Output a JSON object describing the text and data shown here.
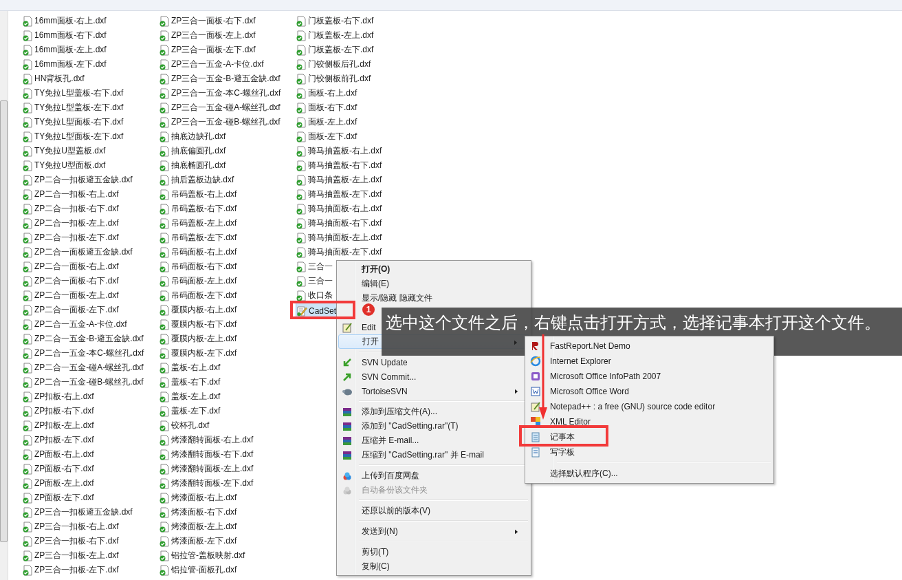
{
  "file_columns": [
    [
      {
        "name": "16mm面板-右上.dxf",
        "kind": "dxf",
        "selected": false
      },
      {
        "name": "16mm面板-右下.dxf",
        "kind": "dxf",
        "selected": false
      },
      {
        "name": "16mm面板-左上.dxf",
        "kind": "dxf",
        "selected": false
      },
      {
        "name": "16mm面板-左下.dxf",
        "kind": "dxf",
        "selected": false
      },
      {
        "name": "HN背板孔.dxf",
        "kind": "dxf",
        "selected": false
      },
      {
        "name": "TY免拉L型盖板-右下.dxf",
        "kind": "dxf",
        "selected": false
      },
      {
        "name": "TY免拉L型盖板-左下.dxf",
        "kind": "dxf",
        "selected": false
      },
      {
        "name": "TY免拉L型面板-右下.dxf",
        "kind": "dxf",
        "selected": false
      },
      {
        "name": "TY免拉L型面板-左下.dxf",
        "kind": "dxf",
        "selected": false
      },
      {
        "name": "TY免拉U型盖板.dxf",
        "kind": "dxf",
        "selected": false
      },
      {
        "name": "TY免拉U型面板.dxf",
        "kind": "dxf",
        "selected": false
      },
      {
        "name": "ZP二合一扣板避五金缺.dxf",
        "kind": "dxf",
        "selected": false
      },
      {
        "name": "ZP二合一扣板-右上.dxf",
        "kind": "dxf",
        "selected": false
      },
      {
        "name": "ZP二合一扣板-右下.dxf",
        "kind": "dxf",
        "selected": false
      },
      {
        "name": "ZP二合一扣板-左上.dxf",
        "kind": "dxf",
        "selected": false
      },
      {
        "name": "ZP二合一扣板-左下.dxf",
        "kind": "dxf",
        "selected": false
      },
      {
        "name": "ZP二合一面板避五金缺.dxf",
        "kind": "dxf",
        "selected": false
      },
      {
        "name": "ZP二合一面板-右上.dxf",
        "kind": "dxf",
        "selected": false
      },
      {
        "name": "ZP二合一面板-右下.dxf",
        "kind": "dxf",
        "selected": false
      },
      {
        "name": "ZP二合一面板-左上.dxf",
        "kind": "dxf",
        "selected": false
      },
      {
        "name": "ZP二合一面板-左下.dxf",
        "kind": "dxf",
        "selected": false
      },
      {
        "name": "ZP二合一五金-A-卡位.dxf",
        "kind": "dxf",
        "selected": false
      },
      {
        "name": "ZP二合一五金-B-避五金缺.dxf",
        "kind": "dxf",
        "selected": false
      },
      {
        "name": "ZP二合一五金-本C-螺丝孔.dxf",
        "kind": "dxf",
        "selected": false
      },
      {
        "name": "ZP二合一五金-碰A-螺丝孔.dxf",
        "kind": "dxf",
        "selected": false
      },
      {
        "name": "ZP二合一五金-碰B-螺丝孔.dxf",
        "kind": "dxf",
        "selected": false
      },
      {
        "name": "ZP扣板-右上.dxf",
        "kind": "dxf",
        "selected": false
      },
      {
        "name": "ZP扣板-右下.dxf",
        "kind": "dxf",
        "selected": false
      },
      {
        "name": "ZP扣板-左上.dxf",
        "kind": "dxf",
        "selected": false
      },
      {
        "name": "ZP扣板-左下.dxf",
        "kind": "dxf",
        "selected": false
      },
      {
        "name": "ZP面板-右上.dxf",
        "kind": "dxf",
        "selected": false
      },
      {
        "name": "ZP面板-右下.dxf",
        "kind": "dxf",
        "selected": false
      },
      {
        "name": "ZP面板-左上.dxf",
        "kind": "dxf",
        "selected": false
      },
      {
        "name": "ZP面板-左下.dxf",
        "kind": "dxf",
        "selected": false
      },
      {
        "name": "ZP三合一扣板避五金缺.dxf",
        "kind": "dxf",
        "selected": false
      },
      {
        "name": "ZP三合一扣板-右上.dxf",
        "kind": "dxf",
        "selected": false
      },
      {
        "name": "ZP三合一扣板-右下.dxf",
        "kind": "dxf",
        "selected": false
      },
      {
        "name": "ZP三合一扣板-左上.dxf",
        "kind": "dxf",
        "selected": false
      },
      {
        "name": "ZP三合一扣板-左下.dxf",
        "kind": "dxf",
        "selected": false
      }
    ],
    [
      {
        "name": "ZP三合一面板-右下.dxf",
        "kind": "dxf",
        "selected": false
      },
      {
        "name": "ZP三合一面板-左上.dxf",
        "kind": "dxf",
        "selected": false
      },
      {
        "name": "ZP三合一面板-左下.dxf",
        "kind": "dxf",
        "selected": false
      },
      {
        "name": "ZP三合一五金-A-卡位.dxf",
        "kind": "dxf",
        "selected": false
      },
      {
        "name": "ZP三合一五金-B-避五金缺.dxf",
        "kind": "dxf",
        "selected": false
      },
      {
        "name": "ZP三合一五金-本C-螺丝孔.dxf",
        "kind": "dxf",
        "selected": false
      },
      {
        "name": "ZP三合一五金-碰A-螺丝孔.dxf",
        "kind": "dxf",
        "selected": false
      },
      {
        "name": "ZP三合一五金-碰B-螺丝孔.dxf",
        "kind": "dxf",
        "selected": false
      },
      {
        "name": "抽底边缺孔.dxf",
        "kind": "dxf",
        "selected": false
      },
      {
        "name": "抽底偏圆孔.dxf",
        "kind": "dxf",
        "selected": false
      },
      {
        "name": "抽底椭圆孔.dxf",
        "kind": "dxf",
        "selected": false
      },
      {
        "name": "抽后盖板边缺.dxf",
        "kind": "dxf",
        "selected": false
      },
      {
        "name": "吊码盖板-右上.dxf",
        "kind": "dxf",
        "selected": false
      },
      {
        "name": "吊码盖板-右下.dxf",
        "kind": "dxf",
        "selected": false
      },
      {
        "name": "吊码盖板-左上.dxf",
        "kind": "dxf",
        "selected": false
      },
      {
        "name": "吊码盖板-左下.dxf",
        "kind": "dxf",
        "selected": false
      },
      {
        "name": "吊码面板-右上.dxf",
        "kind": "dxf",
        "selected": false
      },
      {
        "name": "吊码面板-右下.dxf",
        "kind": "dxf",
        "selected": false
      },
      {
        "name": "吊码面板-左上.dxf",
        "kind": "dxf",
        "selected": false
      },
      {
        "name": "吊码面板-左下.dxf",
        "kind": "dxf",
        "selected": false
      },
      {
        "name": "覆膜内板-右上.dxf",
        "kind": "dxf",
        "selected": false
      },
      {
        "name": "覆膜内板-右下.dxf",
        "kind": "dxf",
        "selected": false
      },
      {
        "name": "覆膜内板-左上.dxf",
        "kind": "dxf",
        "selected": false
      },
      {
        "name": "覆膜内板-左下.dxf",
        "kind": "dxf",
        "selected": false
      },
      {
        "name": "盖板-右上.dxf",
        "kind": "dxf",
        "selected": false
      },
      {
        "name": "盖板-右下.dxf",
        "kind": "dxf",
        "selected": false
      },
      {
        "name": "盖板-左上.dxf",
        "kind": "dxf",
        "selected": false
      },
      {
        "name": "盖板-左下.dxf",
        "kind": "dxf",
        "selected": false
      },
      {
        "name": "铰杯孔.dxf",
        "kind": "dxf",
        "selected": false
      },
      {
        "name": "烤漆翻转面板-右上.dxf",
        "kind": "dxf",
        "selected": false
      },
      {
        "name": "烤漆翻转面板-右下.dxf",
        "kind": "dxf",
        "selected": false
      },
      {
        "name": "烤漆翻转面板-左上.dxf",
        "kind": "dxf",
        "selected": false
      },
      {
        "name": "烤漆翻转面板-左下.dxf",
        "kind": "dxf",
        "selected": false
      },
      {
        "name": "烤漆面板-右上.dxf",
        "kind": "dxf",
        "selected": false
      },
      {
        "name": "烤漆面板-右下.dxf",
        "kind": "dxf",
        "selected": false
      },
      {
        "name": "烤漆面板-左上.dxf",
        "kind": "dxf",
        "selected": false
      },
      {
        "name": "烤漆面板-左下.dxf",
        "kind": "dxf",
        "selected": false
      },
      {
        "name": "铝拉管-盖板映射.dxf",
        "kind": "dxf",
        "selected": false
      },
      {
        "name": "铝拉管-面板孔.dxf",
        "kind": "dxf",
        "selected": false
      }
    ],
    [
      {
        "name": "门板盖板-右下.dxf",
        "kind": "dxf",
        "selected": false
      },
      {
        "name": "门板盖板-左上.dxf",
        "kind": "dxf",
        "selected": false
      },
      {
        "name": "门板盖板-左下.dxf",
        "kind": "dxf",
        "selected": false
      },
      {
        "name": "门铰侧板后孔.dxf",
        "kind": "dxf",
        "selected": false
      },
      {
        "name": "门铰侧板前孔.dxf",
        "kind": "dxf",
        "selected": false
      },
      {
        "name": "面板-右上.dxf",
        "kind": "dxf",
        "selected": false
      },
      {
        "name": "面板-右下.dxf",
        "kind": "dxf",
        "selected": false
      },
      {
        "name": "面板-左上.dxf",
        "kind": "dxf",
        "selected": false
      },
      {
        "name": "面板-左下.dxf",
        "kind": "dxf",
        "selected": false
      },
      {
        "name": "骑马抽盖板-右上.dxf",
        "kind": "dxf",
        "selected": false
      },
      {
        "name": "骑马抽盖板-右下.dxf",
        "kind": "dxf",
        "selected": false
      },
      {
        "name": "骑马抽盖板-左上.dxf",
        "kind": "dxf",
        "selected": false
      },
      {
        "name": "骑马抽盖板-左下.dxf",
        "kind": "dxf",
        "selected": false
      },
      {
        "name": "骑马抽面板-右上.dxf",
        "kind": "dxf",
        "selected": false
      },
      {
        "name": "骑马抽面板-右下.dxf",
        "kind": "dxf",
        "selected": false
      },
      {
        "name": "骑马抽面板-左上.dxf",
        "kind": "dxf",
        "selected": false
      },
      {
        "name": "骑马抽面板-左下.dxf",
        "kind": "dxf",
        "selected": false
      },
      {
        "name": "三合一",
        "kind": "dxf",
        "selected": false
      },
      {
        "name": "三合一",
        "kind": "dxf",
        "selected": false
      },
      {
        "name": "收口条",
        "kind": "dxf",
        "selected": false
      },
      {
        "name": "CadSet",
        "kind": "text",
        "selected": true
      }
    ]
  ],
  "context_menu": {
    "items": [
      {
        "kind": "item",
        "label": "打开(O)",
        "bold": true,
        "disabled": false,
        "submenu": false,
        "highlighted": false
      },
      {
        "kind": "item",
        "label": "编辑(E)",
        "bold": false,
        "disabled": false,
        "submenu": false,
        "highlighted": false
      },
      {
        "kind": "item",
        "label": "显示/隐藏 隐藏文件",
        "bold": false,
        "disabled": false,
        "submenu": false,
        "highlighted": false
      },
      {
        "kind": "covered"
      },
      {
        "kind": "item",
        "label": "Edit",
        "bold": false,
        "disabled": false,
        "submenu": false,
        "highlighted": false
      },
      {
        "kind": "item",
        "label": "打开",
        "bold": false,
        "disabled": false,
        "submenu": true,
        "highlighted": true
      },
      {
        "kind": "separator"
      },
      {
        "kind": "item",
        "label": "SVN Update",
        "bold": false,
        "disabled": false,
        "submenu": false,
        "highlighted": false
      },
      {
        "kind": "item",
        "label": "SVN Commit...",
        "bold": false,
        "disabled": false,
        "submenu": false,
        "highlighted": false
      },
      {
        "kind": "item",
        "label": "TortoiseSVN",
        "bold": false,
        "disabled": false,
        "submenu": true,
        "highlighted": false
      },
      {
        "kind": "separator"
      },
      {
        "kind": "item",
        "label": "添加到压缩文件(A)...",
        "bold": false,
        "disabled": false,
        "submenu": false,
        "highlighted": false
      },
      {
        "kind": "item",
        "label": "添加到 \"CadSetting.rar\"(T)",
        "bold": false,
        "disabled": false,
        "submenu": false,
        "highlighted": false
      },
      {
        "kind": "item",
        "label": "压缩并 E-mail...",
        "bold": false,
        "disabled": false,
        "submenu": false,
        "highlighted": false
      },
      {
        "kind": "item",
        "label": "压缩到 \"CadSetting.rar\" 并 E-mail",
        "bold": false,
        "disabled": false,
        "submenu": false,
        "highlighted": false
      },
      {
        "kind": "separator"
      },
      {
        "kind": "item",
        "label": "上传到百度网盘",
        "bold": false,
        "disabled": false,
        "submenu": false,
        "highlighted": false
      },
      {
        "kind": "item",
        "label": "自动备份该文件夹",
        "bold": false,
        "disabled": true,
        "submenu": false,
        "highlighted": false
      },
      {
        "kind": "separator"
      },
      {
        "kind": "item",
        "label": "还原以前的版本(V)",
        "bold": false,
        "disabled": false,
        "submenu": false,
        "highlighted": false
      },
      {
        "kind": "separator"
      },
      {
        "kind": "item",
        "label": "发送到(N)",
        "bold": false,
        "disabled": false,
        "submenu": true,
        "highlighted": false
      },
      {
        "kind": "separator"
      },
      {
        "kind": "item",
        "label": "剪切(T)",
        "bold": false,
        "disabled": false,
        "submenu": false,
        "highlighted": false
      },
      {
        "kind": "item",
        "label": "复制(C)",
        "bold": false,
        "disabled": false,
        "submenu": false,
        "highlighted": false
      }
    ]
  },
  "open_with_submenu": {
    "items": [
      {
        "kind": "item",
        "label": "FastReport.Net Demo",
        "marked": false
      },
      {
        "kind": "item",
        "label": "Internet Explorer",
        "marked": false
      },
      {
        "kind": "item",
        "label": "Microsoft Office InfoPath 2007",
        "marked": false
      },
      {
        "kind": "item",
        "label": "Microsoft Office Word",
        "marked": false
      },
      {
        "kind": "item",
        "label": "Notepad++ : a free (GNU) source code editor",
        "marked": false
      },
      {
        "kind": "item",
        "label": "XML Editor",
        "marked": false
      },
      {
        "kind": "item",
        "label": "记事本",
        "marked": true
      },
      {
        "kind": "item",
        "label": "写字板",
        "marked": false
      },
      {
        "kind": "separator"
      },
      {
        "kind": "item",
        "label": "选择默认程序(C)...",
        "marked": false
      }
    ]
  },
  "callout": {
    "badge": "1",
    "text": "选中这个文件之后，右键点击打开方式，选择记事本打开这个文件。"
  }
}
